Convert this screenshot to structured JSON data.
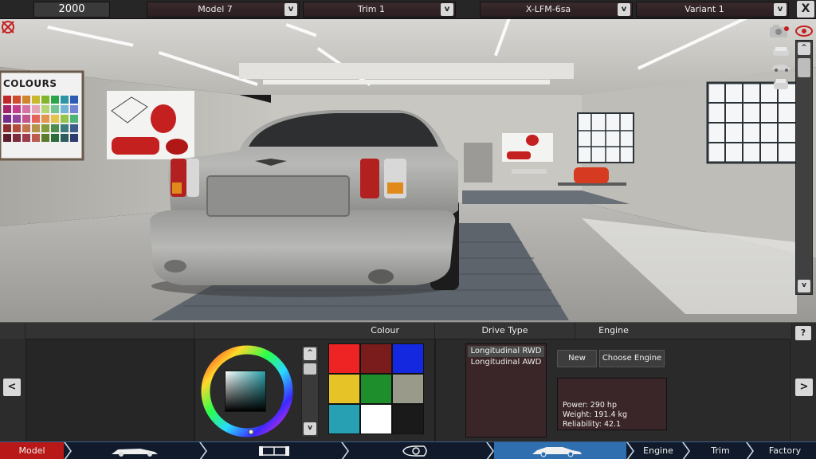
{
  "topbar": {
    "year": "2000",
    "dropdowns": [
      {
        "label": "Model 7"
      },
      {
        "label": "Trim 1"
      },
      {
        "label": "X-LFM-6sa"
      },
      {
        "label": "Variant 1"
      }
    ],
    "dropdown_button": "v",
    "close_label": "X"
  },
  "viewport": {
    "sign_text": "COLOURS",
    "scroll_up": "^",
    "scroll_down": "v"
  },
  "panel": {
    "headers": {
      "colour": "Colour",
      "drive_type": "Drive Type",
      "engine": "Engine"
    },
    "nav_left": "<",
    "nav_right": ">",
    "help": "?",
    "slider_up": "^",
    "slider_down": "v",
    "swatches": [
      "#ee2424",
      "#7a1c1c",
      "#1428e0",
      "#e6c428",
      "#1e8e2c",
      "#9a9a8a",
      "#28a0b4",
      "#ffffff",
      "#1a1a1a"
    ],
    "drive_types": [
      {
        "label": "Longitudinal RWD",
        "selected": true
      },
      {
        "label": "Longitudinal AWD",
        "selected": false
      }
    ],
    "buttons": {
      "new": "New",
      "choose_engine": "Choose Engine"
    },
    "engine_stats": {
      "power": "Power: 290 hp",
      "weight": "Weight: 191.4 kg",
      "reliability": "Reliability: 42.1"
    }
  },
  "nav": {
    "tabs": [
      {
        "label": "Model",
        "active": true
      },
      {
        "icon": "chassis-car-icon"
      },
      {
        "icon": "suspension-icon"
      },
      {
        "icon": "headlight-icon"
      },
      {
        "icon": "body-car-icon",
        "active": true
      },
      {
        "label": "Engine"
      },
      {
        "label": "Trim"
      },
      {
        "label": "Factory"
      }
    ]
  },
  "colors": {
    "accent_red": "#c21a1a",
    "accent_blue": "#2f6fb0",
    "panel_bg": "#2c2c2c"
  }
}
